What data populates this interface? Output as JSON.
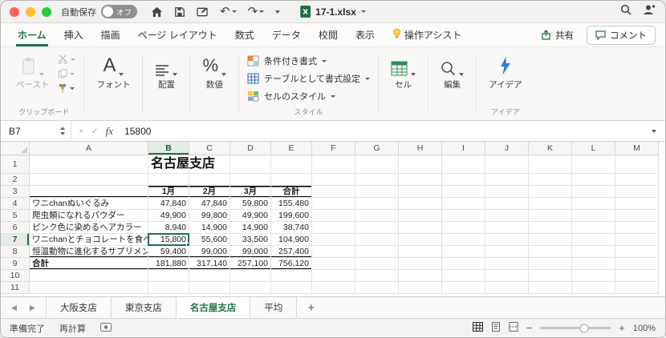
{
  "colors": {
    "accent": "#217346"
  },
  "titlebar": {
    "autosave_label": "自動保存",
    "autosave_state": "オフ",
    "filename": "17-1.xlsx"
  },
  "ribbon": {
    "active_tab": "ホーム",
    "tabs": [
      {
        "id": "home",
        "label": "ホーム"
      },
      {
        "id": "insert",
        "label": "挿入"
      },
      {
        "id": "draw",
        "label": "描画"
      },
      {
        "id": "page-layout",
        "label": "ページ レイアウト"
      },
      {
        "id": "formulas",
        "label": "数式"
      },
      {
        "id": "data",
        "label": "データ"
      },
      {
        "id": "review",
        "label": "校閲"
      },
      {
        "id": "view",
        "label": "表示"
      },
      {
        "id": "tell-me",
        "label": "操作アシスト",
        "icon": "lightbulb-icon"
      }
    ],
    "share_label": "共有",
    "comments_label": "コメント",
    "clipboard": {
      "paste_label": "ペースト",
      "group_label": "クリップボード"
    },
    "font_label": "フォント",
    "alignment_label": "配置",
    "number_label": "数値",
    "style": {
      "conditional_label": "条件付き書式",
      "format_table_label": "テーブルとして書式設定",
      "cell_styles_label": "セルのスタイル",
      "group_label": "スタイル"
    },
    "cells_label": "セル",
    "editing_label": "編集",
    "ideas": {
      "button_label": "アイデア",
      "group_label": "アイデア"
    }
  },
  "formula_bar": {
    "name_box": "B7",
    "fx_label": "fx",
    "formula": "15800"
  },
  "grid": {
    "columns": [
      "A",
      "B",
      "C",
      "D",
      "E",
      "F",
      "G",
      "H",
      "I",
      "J",
      "K",
      "L",
      "M"
    ],
    "rows": [
      "1",
      "2",
      "3",
      "4",
      "5",
      "6",
      "7",
      "8",
      "9",
      "10",
      "11"
    ],
    "selected_cell": "B7",
    "title": "名古屋支店",
    "table": {
      "header": [
        "1月",
        "2月",
        "3月",
        "合計"
      ],
      "rows": [
        {
          "label": "ワニchanぬいぐるみ",
          "values": [
            "47,840",
            "47,840",
            "59,800",
            "155,480"
          ]
        },
        {
          "label": "爬虫類になれるパウダー",
          "values": [
            "49,900",
            "99,800",
            "49,900",
            "199,600"
          ]
        },
        {
          "label": "ピンク色に染めるヘアカラー",
          "values": [
            "8,940",
            "14,900",
            "14,900",
            "38,740"
          ]
        },
        {
          "label": "ワニchanとチョコレートを食べよう！",
          "values": [
            "15,800",
            "55,600",
            "33,500",
            "104,900"
          ]
        },
        {
          "label": "恒温動物に進化するサプリメント",
          "values": [
            "59,400",
            "99,000",
            "99,000",
            "257,400"
          ]
        },
        {
          "label": "合計",
          "bold": true,
          "values": [
            "181,880",
            "317,140",
            "257,100",
            "756,120"
          ]
        }
      ]
    }
  },
  "sheet_tabs": {
    "active": "名古屋支店",
    "tabs": [
      {
        "id": "osaka",
        "label": "大阪支店"
      },
      {
        "id": "tokyo",
        "label": "東京支店"
      },
      {
        "id": "nagoya",
        "label": "名古屋支店"
      },
      {
        "id": "average",
        "label": "平均"
      }
    ]
  },
  "status_bar": {
    "ready_label": "準備完了",
    "calc_label": "再計算",
    "zoom_level": "100%"
  }
}
